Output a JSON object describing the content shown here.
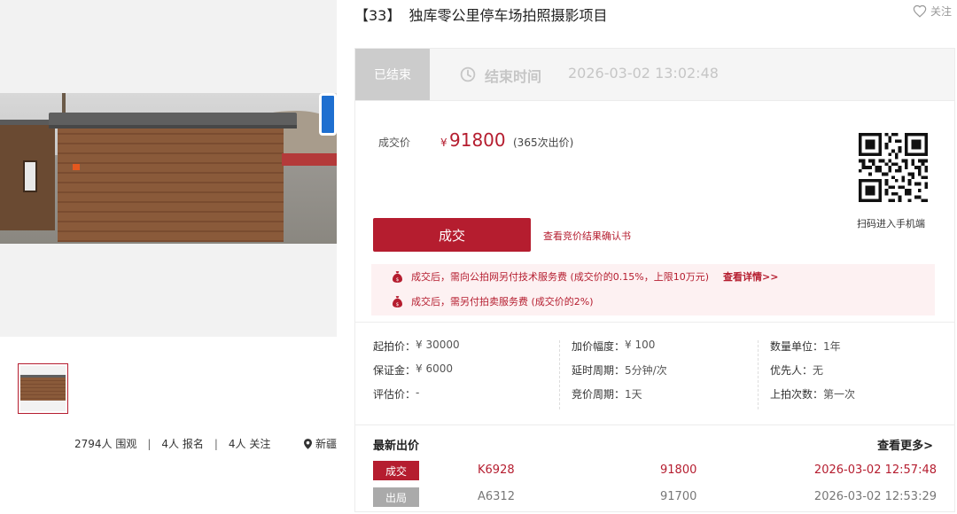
{
  "item": {
    "lot_no": "【33】",
    "title": "独库零公里停车场拍照摄影项目"
  },
  "follow": {
    "label": "关注"
  },
  "status": {
    "tag": "已结束",
    "end_label": "结束时间",
    "end_time": "2026-03-02 13:02:48"
  },
  "price": {
    "label": "成交价",
    "currency": "¥",
    "value": "91800",
    "bids_text": "(365次出价)"
  },
  "qr": {
    "caption": "扫码进入手机端"
  },
  "actions": {
    "deal_button": "成交",
    "confirm_link": "查看竞价结果确认书"
  },
  "notices": [
    {
      "text": "成交后，需向公拍网另付技术服务费 (成交价的0.15%，上限10万元)",
      "link": "查看详情>>"
    },
    {
      "text": "成交后，需另付拍卖服务费 (成交价的2%)"
    }
  ],
  "info": {
    "col1": [
      {
        "k": "起拍价：",
        "v": "¥ 30000"
      },
      {
        "k": "保证金：",
        "v": "¥ 6000"
      },
      {
        "k": "评估价：",
        "v": "-"
      }
    ],
    "col2": [
      {
        "k": "加价幅度：",
        "v": "¥ 100"
      },
      {
        "k": "延时周期：",
        "v": "5分钟/次"
      },
      {
        "k": "竞价周期：",
        "v": "1天"
      }
    ],
    "col3": [
      {
        "k": "数量单位：",
        "v": "1年"
      },
      {
        "k": "优先人：",
        "v": "无"
      },
      {
        "k": "上拍次数：",
        "v": "第一次"
      }
    ]
  },
  "bids": {
    "title": "最新出价",
    "more": "查看更多>",
    "rows": [
      {
        "tag": "成交",
        "bidder": "K6928",
        "amount": "91800",
        "time": "2026-03-02 12:57:48"
      },
      {
        "tag": "出局",
        "bidder": "A6312",
        "amount": "91700",
        "time": "2026-03-02 12:53:29"
      }
    ]
  },
  "stats": {
    "views": "2794人 围观",
    "signups": "4人 报名",
    "follows": "4人 关注",
    "location": "新疆"
  },
  "colors": {
    "accent": "#b51d2f",
    "ended_tag": "#cccccc",
    "outbid_tag": "#aaaaaa",
    "notice_bg": "#fdf1f2"
  }
}
